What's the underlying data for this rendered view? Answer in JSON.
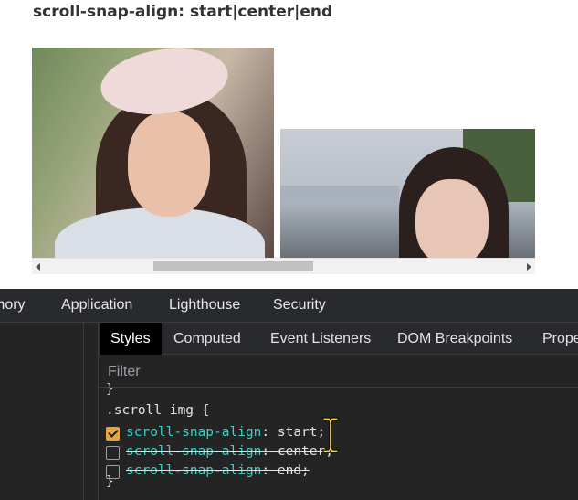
{
  "page": {
    "title": "scroll-snap-align: start|center|end"
  },
  "devtools": {
    "main_tabs": [
      "mory",
      "Application",
      "Lighthouse",
      "Security"
    ],
    "sub_tabs": [
      "Styles",
      "Computed",
      "Event Listeners",
      "DOM Breakpoints",
      "Prope"
    ],
    "active_sub_tab": "Styles",
    "filter": {
      "placeholder": "Filter",
      "value": ""
    },
    "rule": {
      "prev_brace": "}",
      "selector_line": ".scroll img {",
      "declarations": [
        {
          "property": "scroll-snap-align",
          "colon": ":",
          "value": " start;",
          "enabled": true
        },
        {
          "property": "scroll-snap-align",
          "colon": ":",
          "value": " center;",
          "enabled": false
        },
        {
          "property": "scroll-snap-align",
          "colon": ":",
          "value": " end;",
          "enabled": false
        }
      ],
      "close_brace": "}"
    }
  },
  "colors": {
    "devtools_bg": "#242424",
    "tab_bar_bg": "#292a2d",
    "active_tab_bg": "#000000",
    "property_color": "#35d4c7",
    "checkbox_checked": "#e8a33d",
    "cursor": "#f5d42a"
  },
  "icons": {
    "scroll_left": "triangle-left",
    "scroll_right": "triangle-right",
    "cursor": "text-ibeam-cursor"
  }
}
